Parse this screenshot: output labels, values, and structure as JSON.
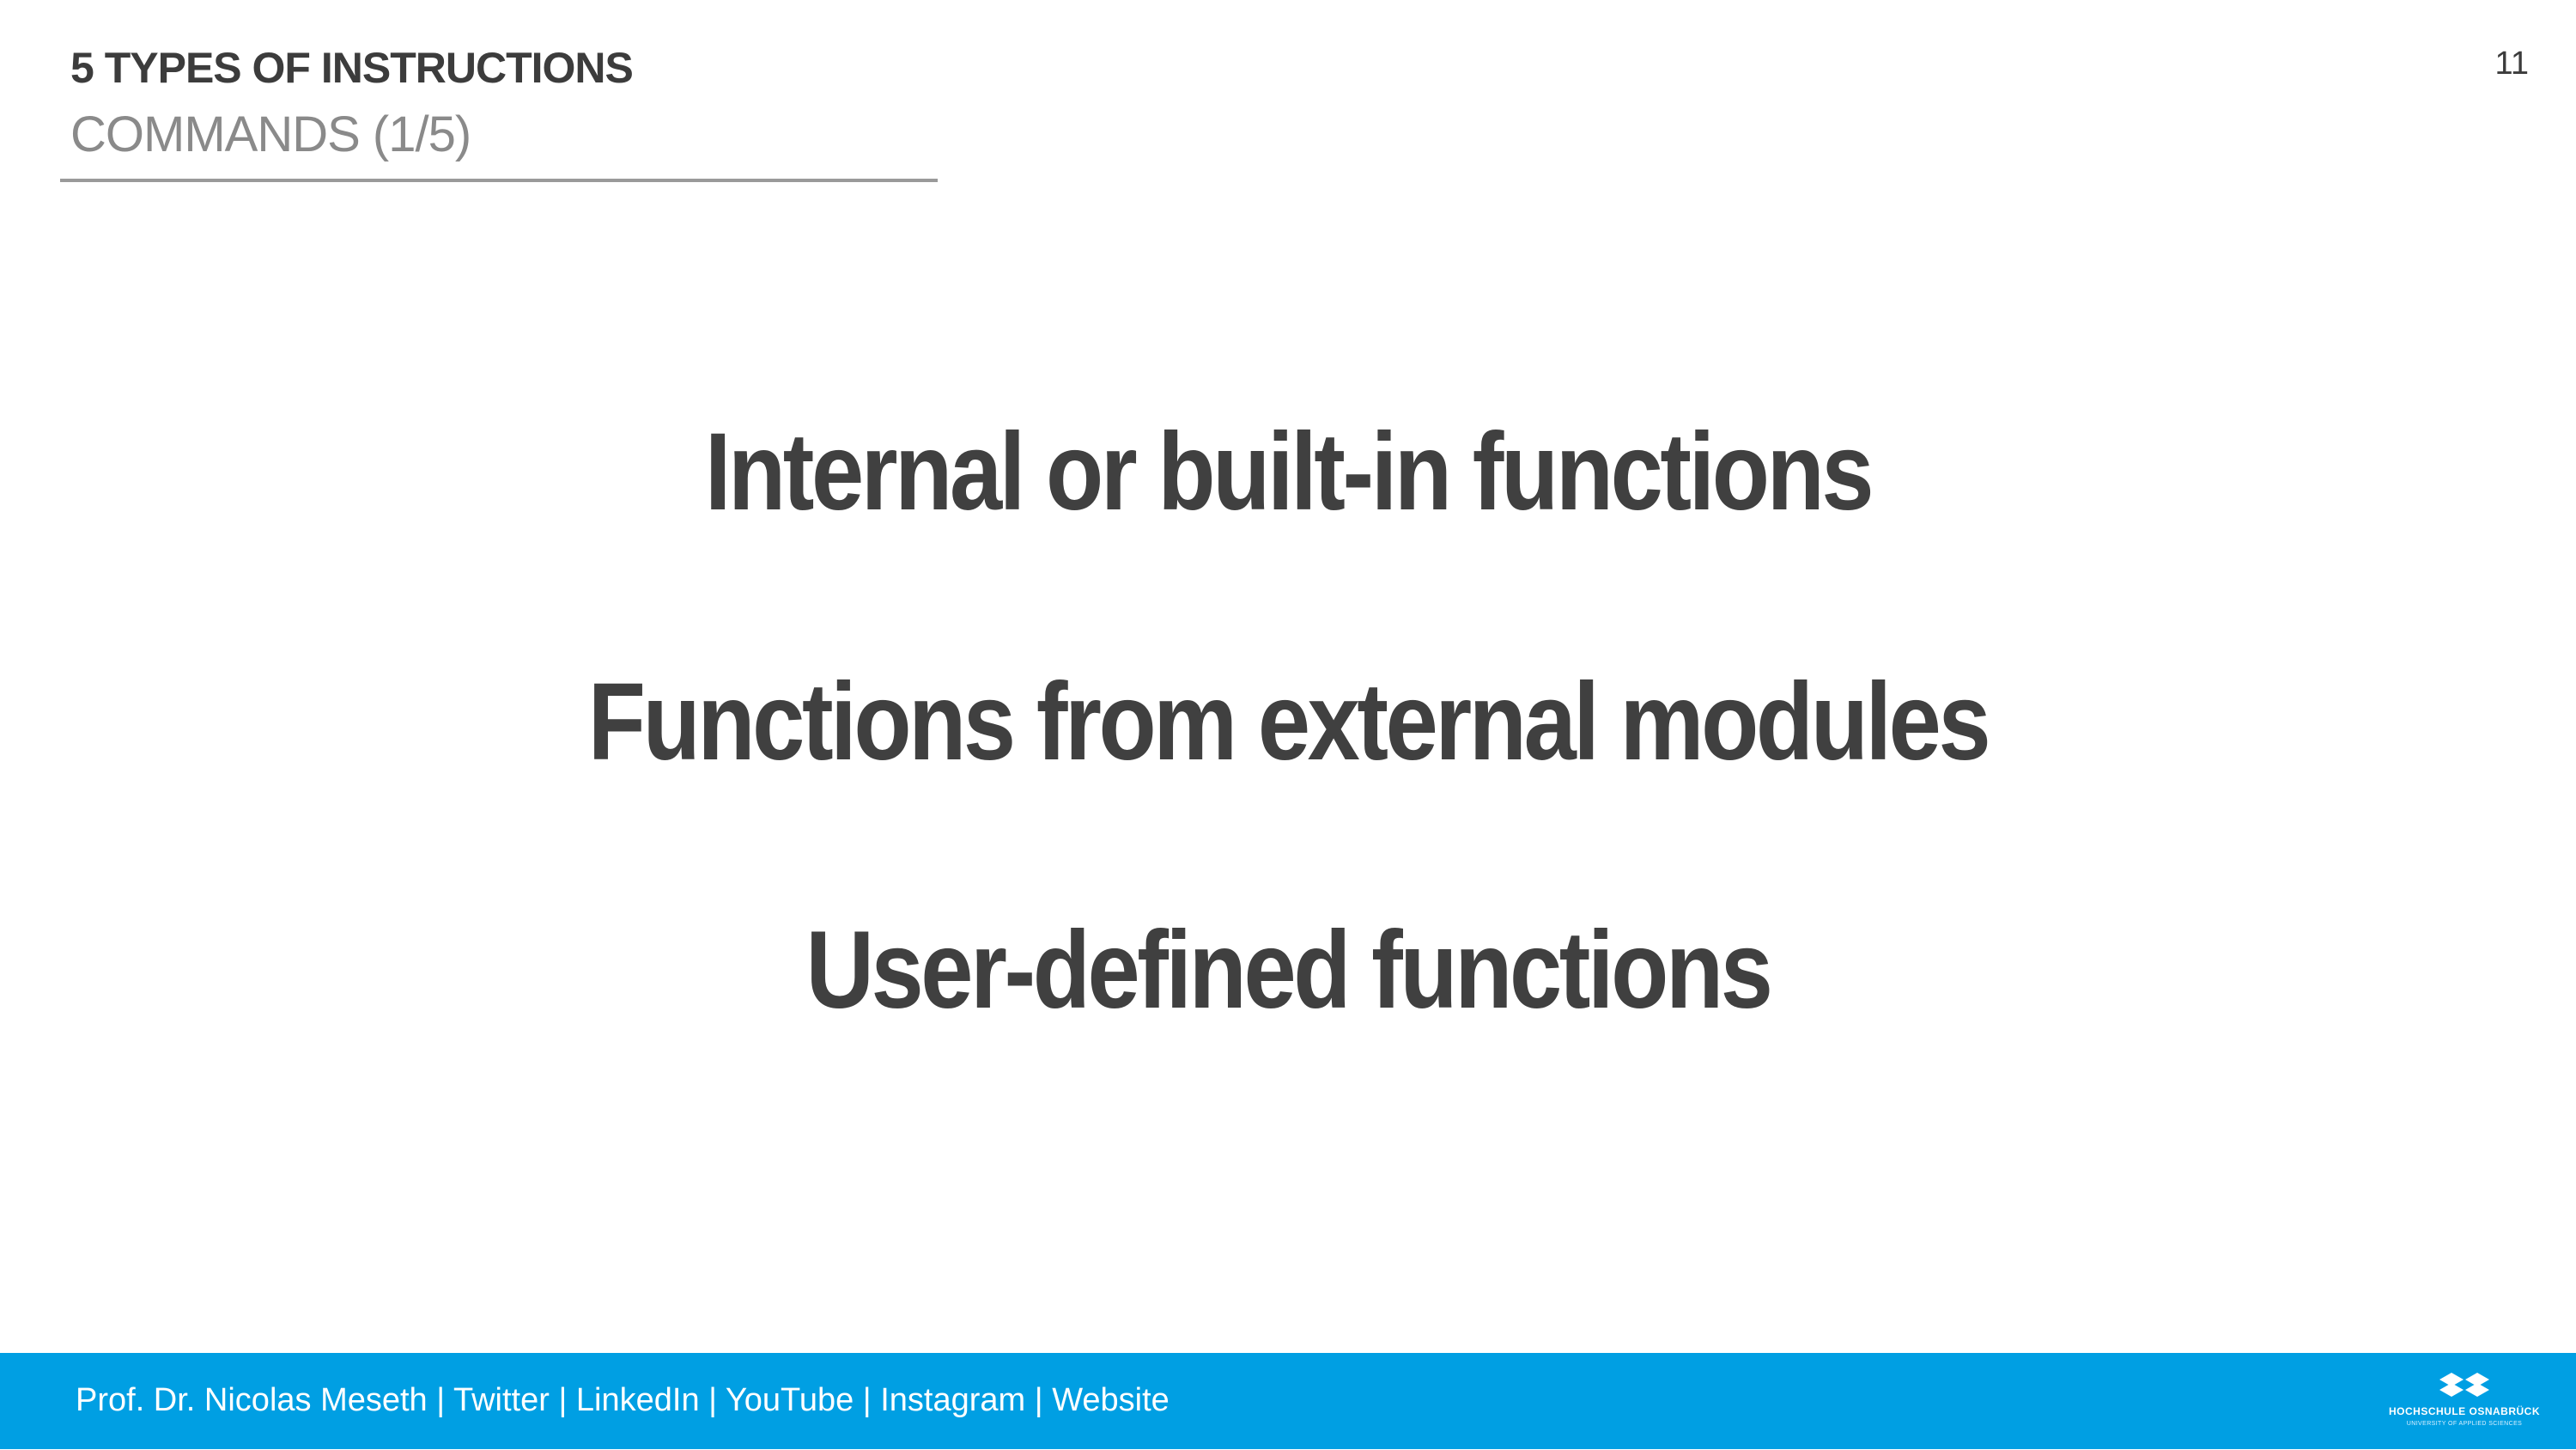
{
  "header": {
    "title": "5 TYPES OF INSTRUCTIONS",
    "subtitle": "COMMANDS (1/5)",
    "page_number": "11"
  },
  "main": {
    "items": [
      "Internal or built-in functions",
      "Functions from external modules",
      "User-defined functions"
    ]
  },
  "footer": {
    "author": "Prof. Dr. Nicolas Meseth",
    "separator": " | ",
    "links": [
      "Twitter",
      "LinkedIn",
      "YouTube",
      "Instagram",
      "Website"
    ],
    "logo_name": "HOCHSCHULE OSNABRÜCK",
    "logo_tagline": "UNIVERSITY OF APPLIED SCIENCES"
  },
  "colors": {
    "title_text": "#3c3c3c",
    "subtitle_text": "#8a8a8a",
    "body_text": "#404040",
    "footer_bar": "#009fe3",
    "footer_text": "#ffffff"
  },
  "icons": {
    "logo": "university-logo-icon"
  }
}
